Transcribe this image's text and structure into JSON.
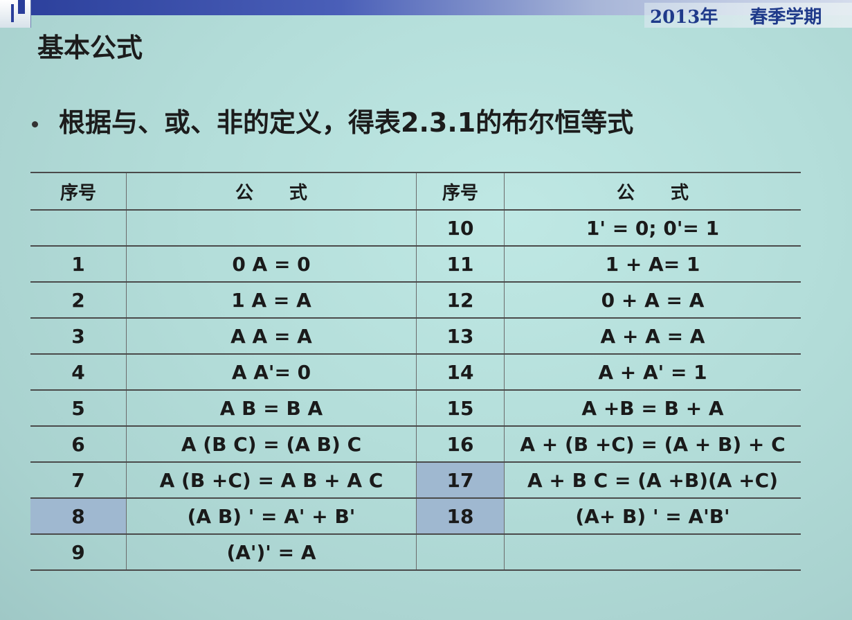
{
  "header": {
    "year_text": "2013年",
    "term_text": "春季学期"
  },
  "slide": {
    "title": "基本公式",
    "bullet": "根据与、或、非的定义，得表2.3.1的布尔恒等式"
  },
  "table": {
    "headers": [
      "序号",
      "公　　式",
      "序号",
      "公　　式"
    ],
    "rows": [
      {
        "no1": "",
        "f1": "",
        "no2": "10",
        "f2": "1' = 0; 0'= 1"
      },
      {
        "no1": "1",
        "f1": "0 A = 0",
        "no2": "11",
        "f2": "1 + A= 1"
      },
      {
        "no1": "2",
        "f1": "1 A = A",
        "no2": "12",
        "f2": "0 + A = A"
      },
      {
        "no1": "3",
        "f1": "A A = A",
        "no2": "13",
        "f2": "A + A = A"
      },
      {
        "no1": "4",
        "f1": "A A'= 0",
        "no2": "14",
        "f2": "A + A' = 1"
      },
      {
        "no1": "5",
        "f1": "A B = B A",
        "no2": "15",
        "f2": "A +B = B + A"
      },
      {
        "no1": "6",
        "f1": "A (B C) = (A B) C",
        "no2": "16",
        "f2": "A + (B +C) = (A + B) + C"
      },
      {
        "no1": "7",
        "f1": "A (B +C) = A B + A C",
        "no2": "17",
        "f2": "A + B C = (A +B)(A +C)"
      },
      {
        "no1": "8",
        "f1": "(A B) ' = A' + B'",
        "no2": "18",
        "f2": "(A+ B) ' = A'B'"
      },
      {
        "no1": "9",
        "f1": "(A')' = A",
        "no2": "",
        "f2": ""
      }
    ]
  },
  "colors": {
    "background": "#b3ddd9",
    "header_bar": "#2a3e9a",
    "highlight_cell": "#9fb8d0"
  }
}
